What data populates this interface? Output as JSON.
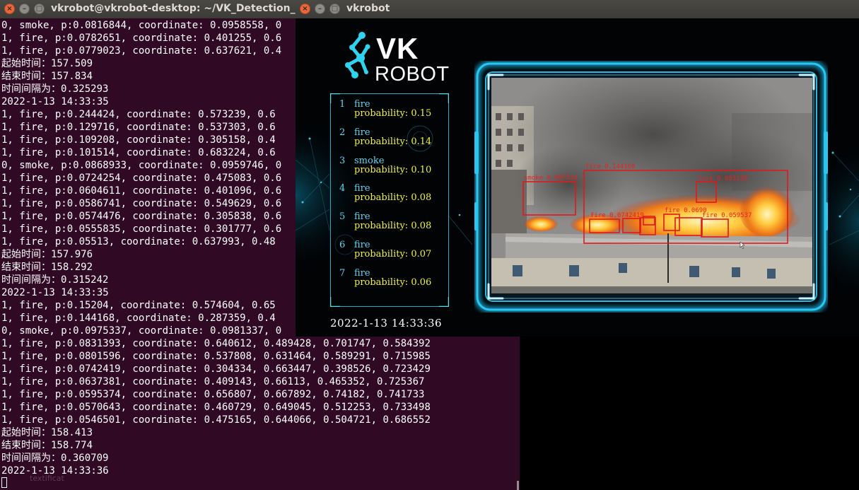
{
  "terminal": {
    "title": "vkrobot@vkrobot-desktop: ~/VK_Detection_GPU",
    "lines": [
      "0, smoke, p:0.0816844, coordinate: 0.0958558, 0",
      "1, fire, p:0.0782651, coordinate: 0.401255, 0.6",
      "1, fire, p:0.0779023, coordinate: 0.637621, 0.4",
      "起始时间：157.509",
      "结束时间：157.834",
      "时间间隔为：0.325293",
      "2022-1-13 14:33:35",
      "1, fire, p:0.244424, coordinate: 0.573239, 0.6",
      "1, fire, p:0.129716, coordinate: 0.537303, 0.6",
      "1, fire, p:0.109208, coordinate: 0.305158, 0.4",
      "1, fire, p:0.101514, coordinate: 0.683224, 0.6",
      "0, smoke, p:0.0868933, coordinate: 0.0959746, 0",
      "1, fire, p:0.0724254, coordinate: 0.475083, 0.6",
      "1, fire, p:0.0604611, coordinate: 0.401096, 0.6",
      "1, fire, p:0.0586741, coordinate: 0.549629, 0.6",
      "1, fire, p:0.0574476, coordinate: 0.305838, 0.6",
      "1, fire, p:0.0555835, coordinate: 0.301777, 0.6",
      "1, fire, p:0.05513, coordinate: 0.637993, 0.48",
      "起始时间：157.976",
      "结束时间：158.292",
      "时间间隔为：0.315242",
      "2022-1-13 14:33:35",
      "1, fire, p:0.15204, coordinate: 0.574604, 0.65",
      "1, fire, p:0.144168, coordinate: 0.287359, 0.4",
      "0, smoke, p:0.0975337, coordinate: 0.0981337, 0",
      "1, fire, p:0.0831393, coordinate: 0.640612, 0.489428, 0.701747, 0.584392",
      "1, fire, p:0.0801596, coordinate: 0.537808, 0.631464, 0.589291, 0.715985",
      "1, fire, p:0.0742419, coordinate: 0.304334, 0.663447, 0.398526, 0.723429",
      "1, fire, p:0.0637381, coordinate: 0.409143, 0.66113, 0.465352, 0.725367",
      "1, fire, p:0.0595374, coordinate: 0.656807, 0.667892, 0.74182, 0.741733",
      "1, fire, p:0.0570643, coordinate: 0.460729, 0.649045, 0.512253, 0.733498",
      "1, fire, p:0.0546501, coordinate: 0.475165, 0.644066, 0.504721, 0.686552",
      "起始时间：158.413",
      "结束时间：158.774",
      "时间间隔为：0.360709",
      "2022-1-13 14:33:36"
    ]
  },
  "vk_window": {
    "title": "vkrobot",
    "logo_vk": "VK",
    "logo_robot": "ROBOT",
    "prob_label": "probability:",
    "detections": [
      {
        "num": "1",
        "cls": "fire",
        "prob": "0.15"
      },
      {
        "num": "2",
        "cls": "fire",
        "prob": "0.14"
      },
      {
        "num": "3",
        "cls": "smoke",
        "prob": "0.10"
      },
      {
        "num": "4",
        "cls": "fire",
        "prob": "0.08"
      },
      {
        "num": "5",
        "cls": "fire",
        "prob": "0.08"
      },
      {
        "num": "6",
        "cls": "fire",
        "prob": "0.07"
      },
      {
        "num": "7",
        "cls": "fire",
        "prob": "0.06"
      }
    ],
    "timestamp": "2022-1-13  14:33:36",
    "video_labels": {
      "smoke": "smoke 0.097534",
      "fire_main": "fire 0.144168",
      "fire_top": "fire 0.083139",
      "fire_mid": "fire 0.0690",
      "fire_right": "fire 0.059537",
      "fire_small": "fire 0.0742419"
    }
  },
  "colors": {
    "terminal_bg": "#300a24",
    "terminal_text": "#ffffff",
    "titlebar": "#3c3b37",
    "close_button": "#e8683c",
    "accent_cyan": "#29a8c4",
    "class_text": "#59d9ef",
    "prob_text": "#f2f23a",
    "box_red": "#e0191b"
  },
  "icons": [
    "close-icon",
    "minimize-icon",
    "maximize-icon",
    "vk-logo-icon"
  ]
}
